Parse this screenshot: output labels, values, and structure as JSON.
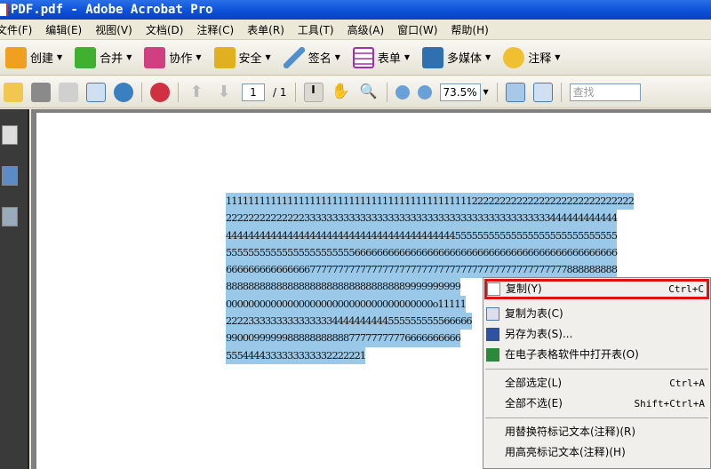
{
  "window": {
    "title": "PDF.pdf - Adobe Acrobat Pro"
  },
  "menubar": [
    "文件(F)",
    "编辑(E)",
    "视图(V)",
    "文档(D)",
    "注释(C)",
    "表单(R)",
    "工具(T)",
    "高级(A)",
    "窗口(W)",
    "帮助(H)"
  ],
  "toolbar1": [
    {
      "label": "创建",
      "icon": "create-icon",
      "color": "#f0a020"
    },
    {
      "label": "合并",
      "icon": "combine-icon",
      "color": "#40b030"
    },
    {
      "label": "协作",
      "icon": "collaborate-icon",
      "color": "#d04080"
    },
    {
      "label": "安全",
      "icon": "lock-icon",
      "color": "#e0b020"
    },
    {
      "label": "签名",
      "icon": "pen-icon",
      "color": "#5090d0"
    },
    {
      "label": "表单",
      "icon": "forms-icon",
      "color": "#a030b0"
    },
    {
      "label": "多媒体",
      "icon": "multimedia-icon",
      "color": "#3070b0"
    },
    {
      "label": "注释",
      "icon": "comment-icon",
      "color": "#f0c030"
    }
  ],
  "toolbar2": {
    "page_current": "1",
    "page_total": "/ 1",
    "zoom": "73.5%",
    "find_placeholder": "查找"
  },
  "document": {
    "lines": [
      "1111111111111111111111111111111111111111111122222222222222222222222222222",
      "2222222222222233333333333333333333333333333333333333333333444444444444",
      "4444444444444444444444444444444444444444455555555555555555555555555555",
      "5555555555555555555555566666666666666666666666666666666666666666666666",
      "6666666666666667777777777777777777777777777777777777777777777888888888",
      "888888888888888888888888888888889999999999",
      "0000000000000000000000000000000000000o11111",
      "22223333333333333334444444444555555555566666",
      "990009999998888888888877777777776666666666",
      "5554444333333333332222221"
    ]
  },
  "context_menu": {
    "items": [
      {
        "label": "复制(Y)",
        "shortcut": "Ctrl+C",
        "icon": "copy-icon",
        "highlighted": true
      },
      {
        "label": "复制为表(C)",
        "icon": "copy-table-icon"
      },
      {
        "label": "另存为表(S)...",
        "icon": "save-icon"
      },
      {
        "label": "在电子表格软件中打开表(O)",
        "icon": "excel-icon"
      },
      {
        "label": "全部选定(L)",
        "shortcut": "Ctrl+A"
      },
      {
        "label": "全部不选(E)",
        "shortcut": "Shift+Ctrl+A"
      },
      {
        "label": "用替换符标记文本(注释)(R)"
      },
      {
        "label": "用高亮标记文本(注释)(H)"
      }
    ]
  }
}
